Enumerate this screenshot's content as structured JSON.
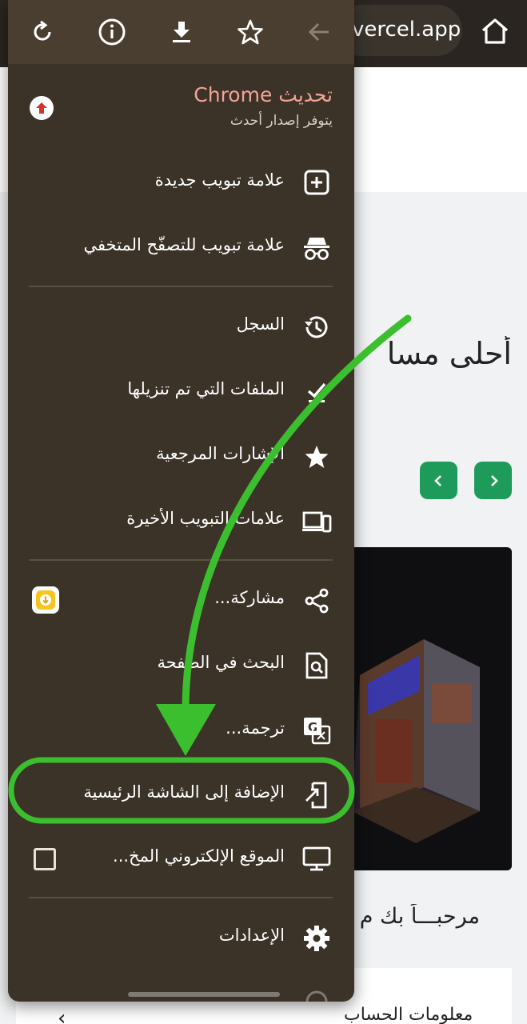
{
  "browser": {
    "url_fragment": "vercel.app",
    "home_icon": "home-icon"
  },
  "menu": {
    "toolbar_icons": [
      "reload-icon",
      "info-icon",
      "download-icon",
      "bookmark-star-icon",
      "back-arrow-icon"
    ],
    "update": {
      "title": "تحديث Chrome",
      "subtitle": "يتوفر إصدار أحدث",
      "color": "#f4a398"
    },
    "items": {
      "new_tab": "علامة تبويب جديدة",
      "incognito_tab": "علامة تبويب للتصفّح المتخفي",
      "history": "السجل",
      "downloads": "الملفات التي تم تنزيلها",
      "bookmarks": "الإشارات المرجعية",
      "recent_tabs": "علامات التبويب الأخيرة",
      "share": "مشاركة...",
      "find_in_page": "البحث في الصفحة",
      "translate": "ترجمة...",
      "add_to_home": "الإضافة إلى الشاشة الرئيسية",
      "desktop_site": "الموقع الإلكتروني المخ...",
      "settings": "الإعدادات"
    },
    "desktop_site_checked": false,
    "background_color": "#3b3228"
  },
  "page": {
    "hero_title": "أحلى مسا",
    "welcome_text": "مرحبـــاً بك م",
    "account_info": "معلومات الحساب",
    "accent_color": "#1e9a5b"
  },
  "annotation": {
    "color": "#3cbf2f"
  }
}
